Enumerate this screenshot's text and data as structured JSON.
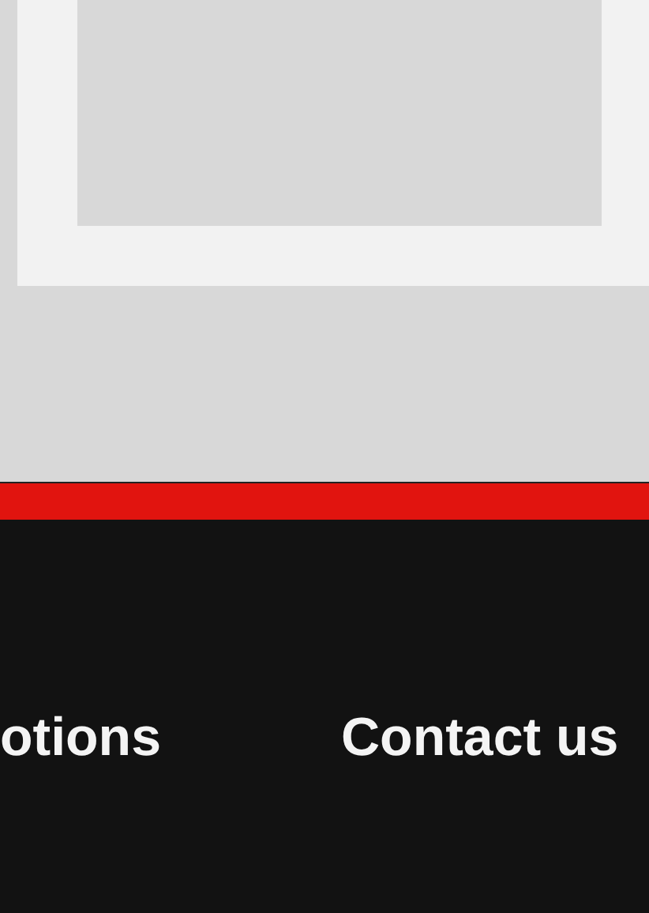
{
  "footer": {
    "links": [
      {
        "label": "otions"
      },
      {
        "label": "Contact us"
      }
    ]
  }
}
